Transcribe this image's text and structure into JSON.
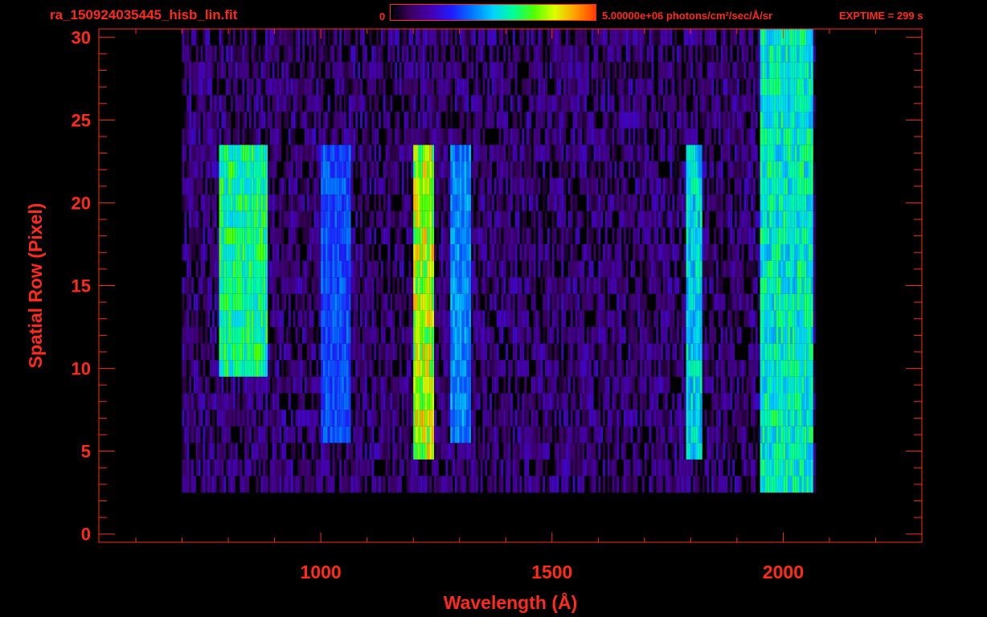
{
  "header": {
    "file_title": "ra_150924035445_hisb_lin.fit",
    "colorbar_min_label": "0",
    "colorbar_max_label": "5.00000e+06 photons/cm²/sec/Å/sr",
    "exptime_label": "EXPTIME = 299 s"
  },
  "colors": {
    "axis": "#ff2a1a",
    "background": "#000000",
    "colormap": [
      "#000000",
      "#3c0064",
      "#4600b4",
      "#1e1eff",
      "#0078ff",
      "#00d2ff",
      "#00ff96",
      "#50ff00",
      "#dcff00",
      "#ffa000",
      "#ff3c00"
    ]
  },
  "chart_data": {
    "type": "heatmap",
    "title": "ra_150924035445_hisb_lin.fit",
    "xlabel": "Wavelength (Å)",
    "ylabel": "Spatial Row (Pixel)",
    "x_ticks": [
      "1000",
      "1500",
      "2000"
    ],
    "y_ticks": [
      "0",
      "5",
      "10",
      "15",
      "20",
      "25",
      "30"
    ],
    "xlim": [
      520,
      2300
    ],
    "ylim": [
      -0.5,
      30.5
    ],
    "color_scale": {
      "min": 0,
      "max": 5000000,
      "units": "photons/cm²/sec/Å/sr",
      "scale": "linear"
    },
    "data_wavelength_range": [
      700,
      2070
    ],
    "signal_rows": [
      3,
      30
    ],
    "features": [
      {
        "wavelength_range": [
          780,
          880
        ],
        "rows": [
          10,
          23
        ],
        "peak_fraction": 0.65
      },
      {
        "wavelength_range": [
          1000,
          1060
        ],
        "rows": [
          6,
          23
        ],
        "peak_fraction": 0.38
      },
      {
        "wavelength_range": [
          1200,
          1240
        ],
        "rows": [
          5,
          23
        ],
        "peak_fraction": 0.82
      },
      {
        "wavelength_range": [
          1280,
          1320
        ],
        "rows": [
          6,
          23
        ],
        "peak_fraction": 0.45
      },
      {
        "wavelength_range": [
          1790,
          1820
        ],
        "rows": [
          5,
          23
        ],
        "peak_fraction": 0.55
      },
      {
        "wavelength_range": [
          1950,
          2060
        ],
        "rows": [
          3,
          30
        ],
        "peak_fraction": 0.6
      }
    ]
  }
}
